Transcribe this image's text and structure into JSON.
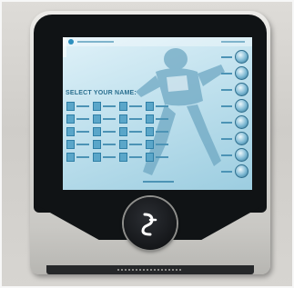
{
  "screen": {
    "title": "SELECT YOUR NAME:"
  },
  "name_buttons_count": 20,
  "avatars_count": 8,
  "colors": {
    "kiosk_body": "#d5d4d0",
    "kiosk_face": "#101315",
    "screen_background": "#c4e3ef",
    "accent": "#2d8fbe"
  },
  "icons": {
    "reader": "contactless-icon"
  }
}
